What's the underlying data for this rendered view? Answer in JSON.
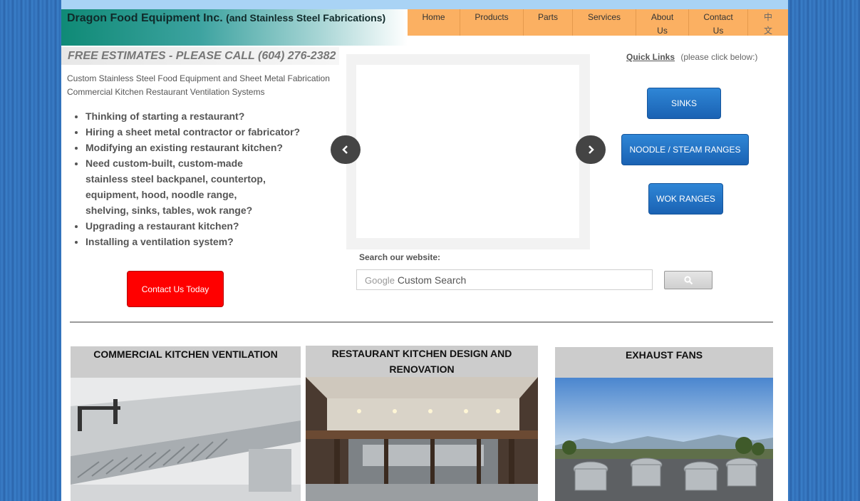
{
  "header": {
    "company": "Dragon Food Equipment Inc.",
    "company_sub": "(and Stainless Steel Fabrications)"
  },
  "nav": [
    {
      "label": "Home",
      "name": "nav-home"
    },
    {
      "label": "Products",
      "name": "nav-products"
    },
    {
      "label": "Parts",
      "name": "nav-parts"
    },
    {
      "label": "Services",
      "name": "nav-services"
    },
    {
      "label": "About Us",
      "name": "nav-about-us"
    },
    {
      "label": "Contact Us",
      "name": "nav-contact-us"
    },
    {
      "label": "中文",
      "name": "nav-chinese"
    }
  ],
  "intro": {
    "estimate": "FREE ESTIMATES - PLEASE CALL (604) 276-2382",
    "desc_line1": "Custom Stainless Steel Food Equipment and Sheet Metal Fabrication",
    "desc_line2": "Commercial Kitchen Restaurant Ventilation Systems",
    "bullets": [
      "Thinking of starting a restaurant?",
      "Hiring a sheet metal contractor or fabricator?",
      "Modifying an existing restaurant kitchen?",
      "Need custom-built, custom-made stainless steel backpanel, countertop, equipment, hood, noodle range, shelving, sinks, tables, wok range?",
      "Upgrading a restaurant kitchen?",
      "Installing a ventilation system?"
    ],
    "contact_button": "Contact Us Today"
  },
  "search": {
    "label": "Search our website:",
    "brand": "Google",
    "placeholder": "Custom Search"
  },
  "quick_links": {
    "title": "Quick Links",
    "hint": "(please click below:)",
    "buttons": [
      "SINKS",
      "NOODLE / STEAM RANGES",
      "WOK RANGES"
    ]
  },
  "cards": [
    {
      "title": "COMMERCIAL KITCHEN VENTILATION"
    },
    {
      "title": "RESTAURANT KITCHEN DESIGN AND RENOVATION"
    },
    {
      "title": "EXHAUST FANS"
    }
  ],
  "colors": {
    "nav_bg": "#fbb062",
    "contact_button": "#ff0000",
    "quick_link_button": "#1f6fc2",
    "card_title_bg": "#cccccc"
  }
}
